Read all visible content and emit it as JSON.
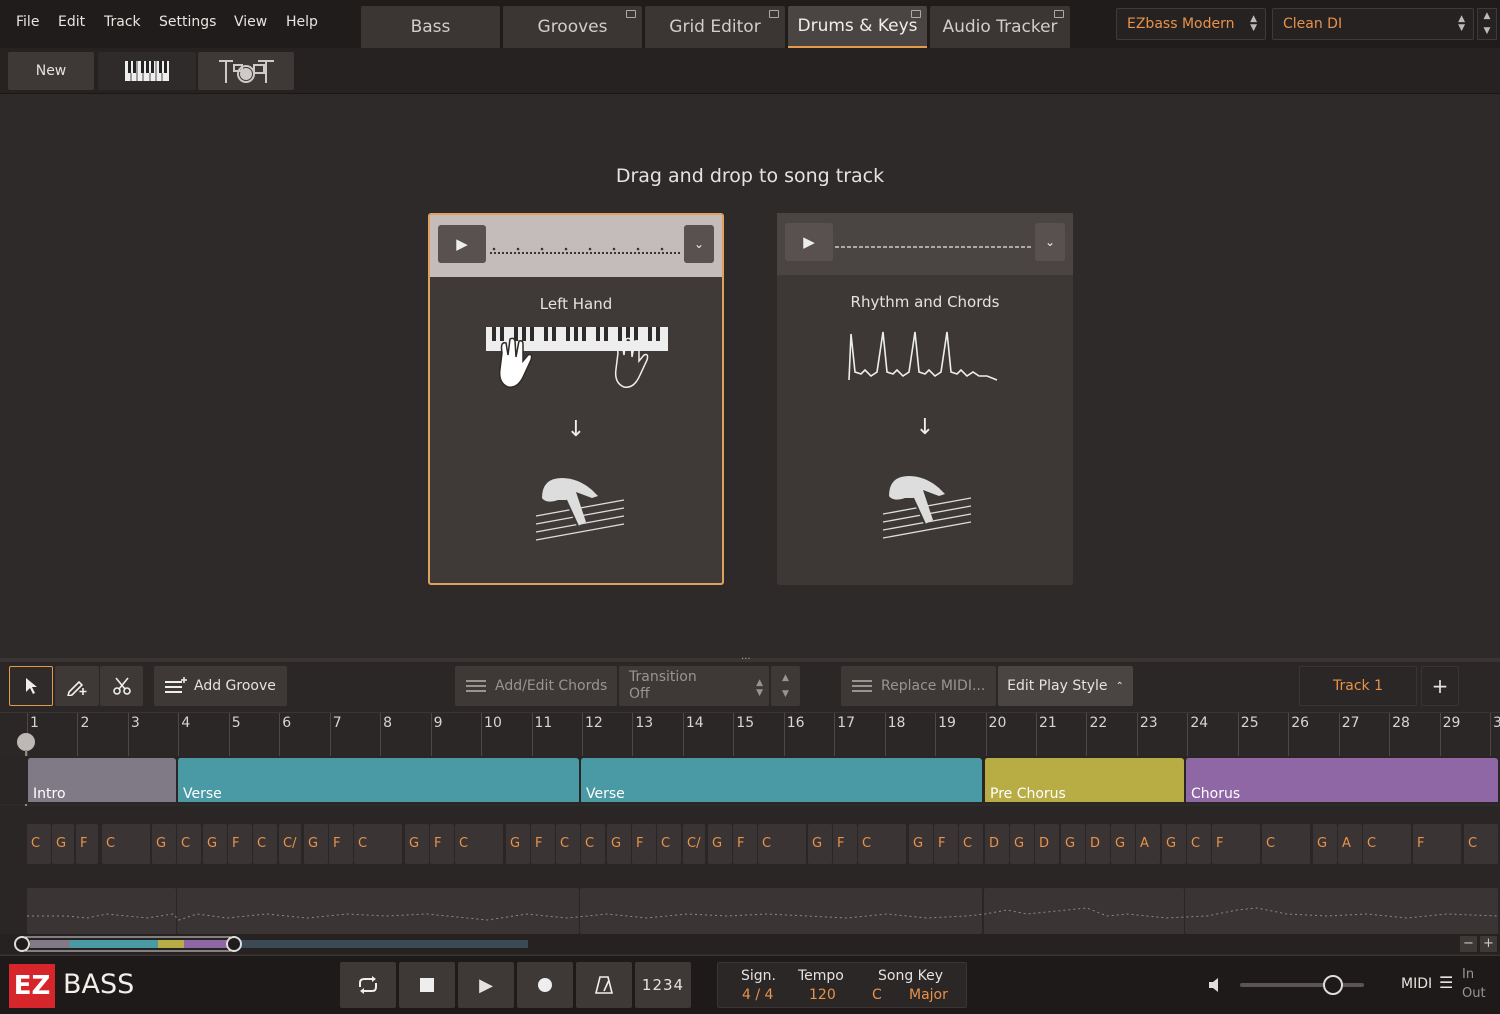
{
  "menu": [
    "File",
    "Edit",
    "Track",
    "Settings",
    "View",
    "Help"
  ],
  "tabs": [
    {
      "label": "Bass"
    },
    {
      "label": "Grooves"
    },
    {
      "label": "Grid Editor"
    },
    {
      "label": "Drums & Keys"
    },
    {
      "label": "Audio Tracker"
    }
  ],
  "active_tab": "Drums & Keys",
  "presets": {
    "library": "EZbass Modern",
    "sound": "Clean DI"
  },
  "toolbar2": {
    "new_label": "New"
  },
  "main": {
    "title": "Drag and drop to song track",
    "cards": [
      {
        "title": "Left Hand"
      },
      {
        "title": "Rhythm and Chords"
      }
    ]
  },
  "bottom_toolbar": {
    "add_groove": "Add Groove",
    "add_edit_chords": "Add/Edit Chords",
    "transition_label": "Transition",
    "transition_value": "Off",
    "replace_midi": "Replace MIDI...",
    "edit_play_style": "Edit Play Style",
    "track_name": "Track 1"
  },
  "ruler_bars": [
    "1",
    "2",
    "3",
    "4",
    "5",
    "6",
    "7",
    "8",
    "9",
    "10",
    "11",
    "12",
    "13",
    "14",
    "15",
    "16",
    "17",
    "18",
    "19",
    "20",
    "21",
    "22",
    "23",
    "24",
    "25",
    "26",
    "27",
    "28",
    "29",
    "3"
  ],
  "sections": [
    {
      "label": "Intro",
      "color": "#7f7a86"
    },
    {
      "label": "Verse",
      "color": "#4a9aa5"
    },
    {
      "label": "Verse",
      "color": "#4a9aa5"
    },
    {
      "label": "Pre Chorus",
      "color": "#b8ad45"
    },
    {
      "label": "Chorus",
      "color": "#8f67a5"
    }
  ],
  "chords": [
    "C",
    "G",
    "F",
    "C",
    "G",
    "C",
    "G",
    "F",
    "C",
    "C/",
    "G",
    "F",
    "C",
    "G",
    "F",
    "C",
    "G",
    "F",
    "C",
    "C",
    "G",
    "F",
    "C",
    "C/",
    "G",
    "F",
    "C",
    "G",
    "F",
    "C",
    "G",
    "F",
    "C",
    "D",
    "G",
    "D",
    "G",
    "D",
    "G",
    "A",
    "G",
    "C",
    "F",
    "C",
    "G",
    "A",
    "C",
    "F",
    "C"
  ],
  "transport": {
    "logo_ez": "EZ",
    "logo_bass": "BASS",
    "count_in": "1234",
    "sign_label": "Sign.",
    "sign_value": "4 / 4",
    "tempo_label": "Tempo",
    "tempo_value": "120",
    "key_label": "Song Key",
    "key_root": "C",
    "key_mode": "Major",
    "midi_label": "MIDI",
    "in_label": "In",
    "out_label": "Out"
  },
  "colors": {
    "accent": "#e8924a",
    "selected_border": "#e0a05e"
  }
}
